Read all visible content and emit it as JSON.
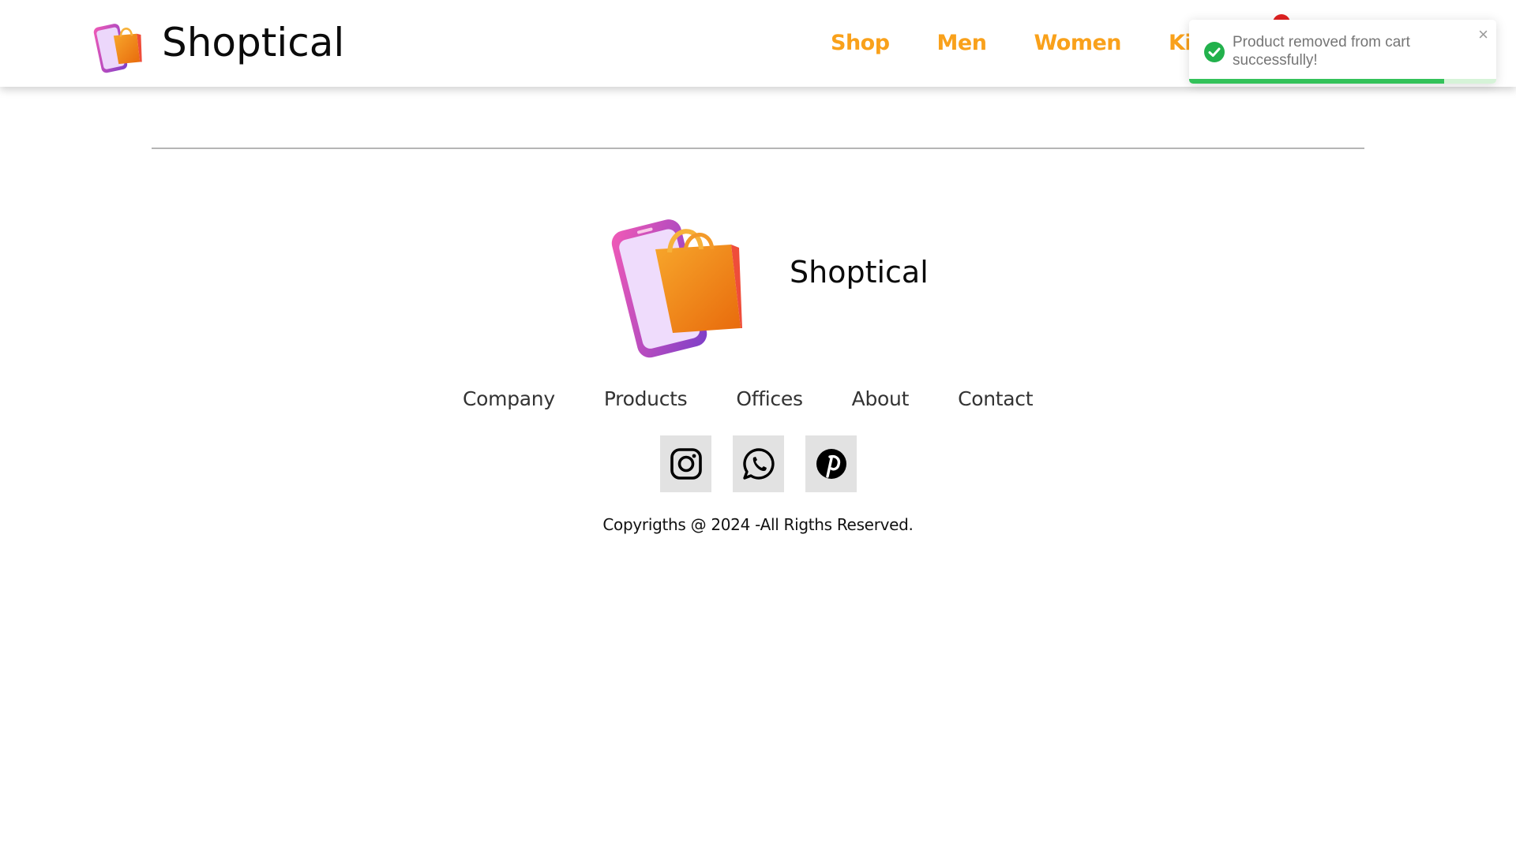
{
  "header": {
    "brand_name": "Shoptical",
    "nav": [
      "Shop",
      "Men",
      "Women",
      "Kids"
    ]
  },
  "toast": {
    "message": "Product removed from cart successfully!",
    "close_label": "×",
    "progress_fraction": 0.83,
    "status": "success"
  },
  "footer": {
    "brand_name": "Shoptical",
    "links": [
      "Company",
      "Products",
      "Offices",
      "About",
      "Contact"
    ],
    "social_icons": [
      "instagram-icon",
      "whatsapp-icon",
      "pinterest-icon"
    ],
    "copyright": "Copyrigths @ 2024 -All Rigths Reserved."
  },
  "colors": {
    "nav_accent": "#f9a11b",
    "success": "#33c25a",
    "badge": "#e02222",
    "social_bg": "#e2e2e2"
  }
}
